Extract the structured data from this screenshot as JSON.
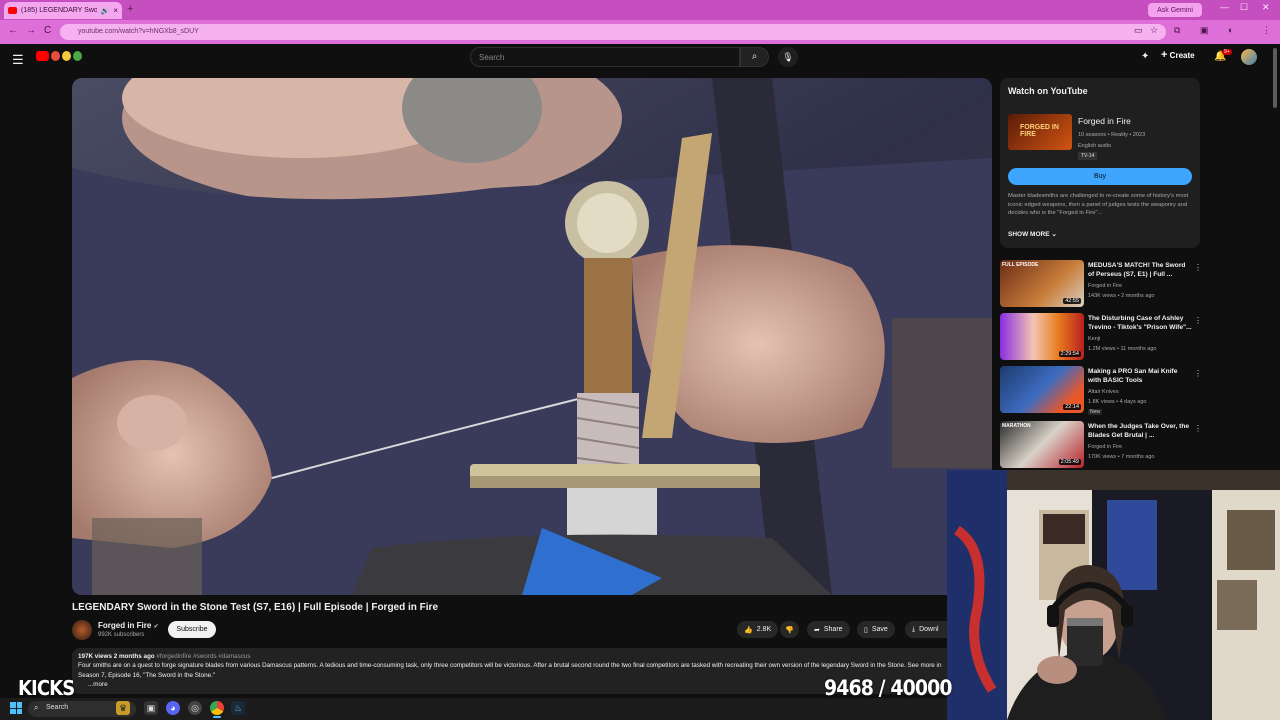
{
  "browser": {
    "tab_title": "(185) LEGENDARY Sword in...",
    "tab_close": "×",
    "new_tab": "+",
    "ask_gemini": "Ask Gemini",
    "url": "youtube.com/watch?v=hNGXb8_sDUY",
    "nav_back": "←",
    "nav_forward": "→",
    "nav_reload": "C",
    "minimize": "—",
    "maximize": "☐",
    "close": "✕"
  },
  "youtube": {
    "search_placeholder": "Search",
    "create_label": "Create",
    "notifications_count": "9+"
  },
  "video": {
    "title": "LEGENDARY Sword in the Stone Test (S7, E16) | Full Episode | Forged in Fire",
    "channel": "Forged in Fire",
    "subscribers": "992K subscribers",
    "subscribe_label": "Subscribe",
    "likes": "2.8K",
    "share_label": "Share",
    "save_label": "Save",
    "download_label": "Downl",
    "views_date": "197K views  2 months ago",
    "hashtags": "#forgedinfire #swords #damascus",
    "description": "Four smiths are on a quest to forge signature blades from various Damascus patterns. A tedious and time-consuming task, only three competitors will be victorious. After a brutal second round the two final competitors are tasked with recreating their own version of the legendary Sword in the Stone. See more in Season 7, Episode 16, \"The Sword in the Stone.\"",
    "more_label": "...more"
  },
  "sidebar": {
    "watch_title": "Watch on YouTube",
    "show_title": "Forged in Fire",
    "show_thumb_text": "FORGED IN FIRE",
    "show_meta": "10 seasons • Reality • 2023",
    "show_audio": "English audio",
    "show_rating": "TV-14",
    "buy_label": "Buy",
    "show_desc": "Master bladesmiths are challenged to re-create some of history's most iconic edged weapons, then a panel of judges tests the weaponry and decides who is the \"Forged in Fire\"...",
    "show_more": "SHOW MORE",
    "recs": [
      {
        "title": "MEDUSA'S MATCH! The Sword of Perseus (S7, E1) | Full ...",
        "channel": "Forged in Fire",
        "meta": "143K views • 2 months ago",
        "duration": "42:55",
        "thumb_label": "FULL EPISODE",
        "badge": ""
      },
      {
        "title": "The Disturbing Case of Ashley Trevino - Tiktok's \"Prison Wife\"...",
        "channel": "Kenji",
        "meta": "1.2M views • 11 months ago",
        "duration": "2:29:54",
        "thumb_label": "",
        "badge": ""
      },
      {
        "title": "Making a PRO San Mai Knife with BASIC Tools",
        "channel": "Altair Knives",
        "meta": "1.8K views • 4 days ago",
        "duration": "22:14",
        "thumb_label": "",
        "badge": "New"
      },
      {
        "title": "When the Judges Take Over, the Blades Get Brutal | ...",
        "channel": "Forged in Fire",
        "meta": "170K views • 7 months ago",
        "duration": "2:05:49",
        "thumb_label": "MARATHON",
        "badge": ""
      }
    ]
  },
  "overlay": {
    "kicks_label": "KICKS",
    "counter": "9468 / 40000"
  },
  "taskbar": {
    "search_label": "Search"
  }
}
